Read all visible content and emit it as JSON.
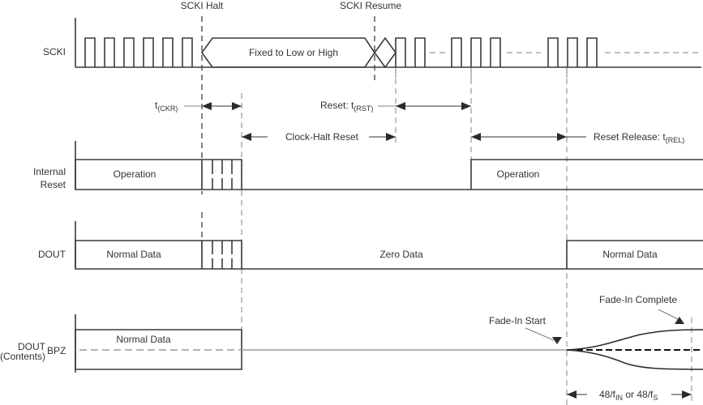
{
  "diagram": {
    "type": "timing-diagram",
    "markers": {
      "scki_halt": "SCKI Halt",
      "scki_resume": "SCKI Resume"
    },
    "signals": {
      "scki": {
        "label": "SCKI",
        "fixed_label": "Fixed to Low or High"
      },
      "internal_reset": {
        "label_line1": "Internal",
        "label_line2": "Reset",
        "segment_before": "Operation",
        "segment_after": "Operation"
      },
      "dout": {
        "label": "DOUT",
        "segment_before": "Normal Data",
        "segment_middle": "Zero Data",
        "segment_after": "Normal Data"
      },
      "dout_bpz": {
        "label_main": "DOUT",
        "label_sub": "(Contents)",
        "label_suffix": "BPZ",
        "segment_before": "Normal Data"
      }
    },
    "timings": {
      "t_ckr": {
        "prefix": "t",
        "subscript": "(CKR)"
      },
      "clock_halt_reset": "Clock-Halt Reset",
      "t_rst": {
        "prefix": "Reset: t",
        "subscript": "(RST)"
      },
      "t_rel": {
        "prefix": "Reset Release: t",
        "subscript": "(REL)"
      },
      "fade_duration": {
        "part1": "48/f",
        "sub1": "IN",
        "part2": " or 48/f",
        "sub2": "S"
      }
    },
    "annotations": {
      "fade_in_start": "Fade-In Start",
      "fade_in_complete": "Fade-In Complete"
    }
  }
}
